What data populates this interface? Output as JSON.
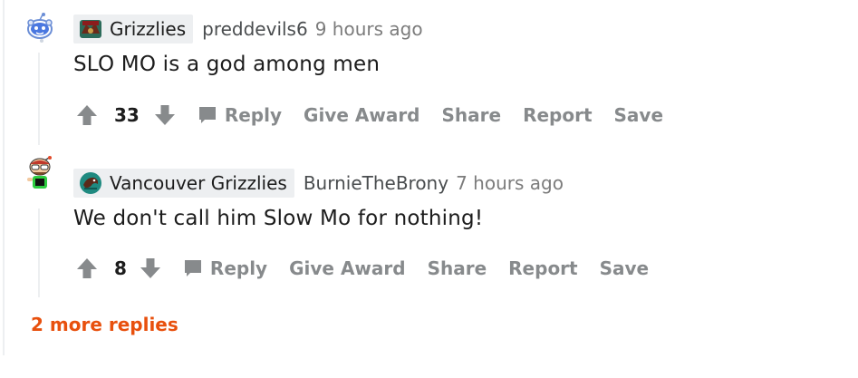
{
  "colors": {
    "text_primary": "#1c1c1c",
    "text_muted": "#878a8c",
    "flair_bg": "#edeff1",
    "more_replies": "#e8500d"
  },
  "comments": [
    {
      "avatar_icon": "snoo-avatar-icon",
      "flair": {
        "icon": "grizzlies-logo-icon",
        "label": "Grizzlies"
      },
      "username": "preddevils6",
      "time": "9 hours ago",
      "body": "SLO MO is a god among men",
      "score": "33",
      "actions": {
        "reply": "Reply",
        "award": "Give Award",
        "share": "Share",
        "report": "Report",
        "save": "Save"
      }
    },
    {
      "avatar_icon": "custom-avatar-icon",
      "flair": {
        "icon": "vancouver-grizzlies-logo-icon",
        "label": "Vancouver Grizzlies"
      },
      "username": "BurnieTheBrony",
      "time": "7 hours ago",
      "body": "We don't call him Slow Mo for nothing!",
      "score": "8",
      "actions": {
        "reply": "Reply",
        "award": "Give Award",
        "share": "Share",
        "report": "Report",
        "save": "Save"
      }
    }
  ],
  "more_replies": "2 more replies"
}
